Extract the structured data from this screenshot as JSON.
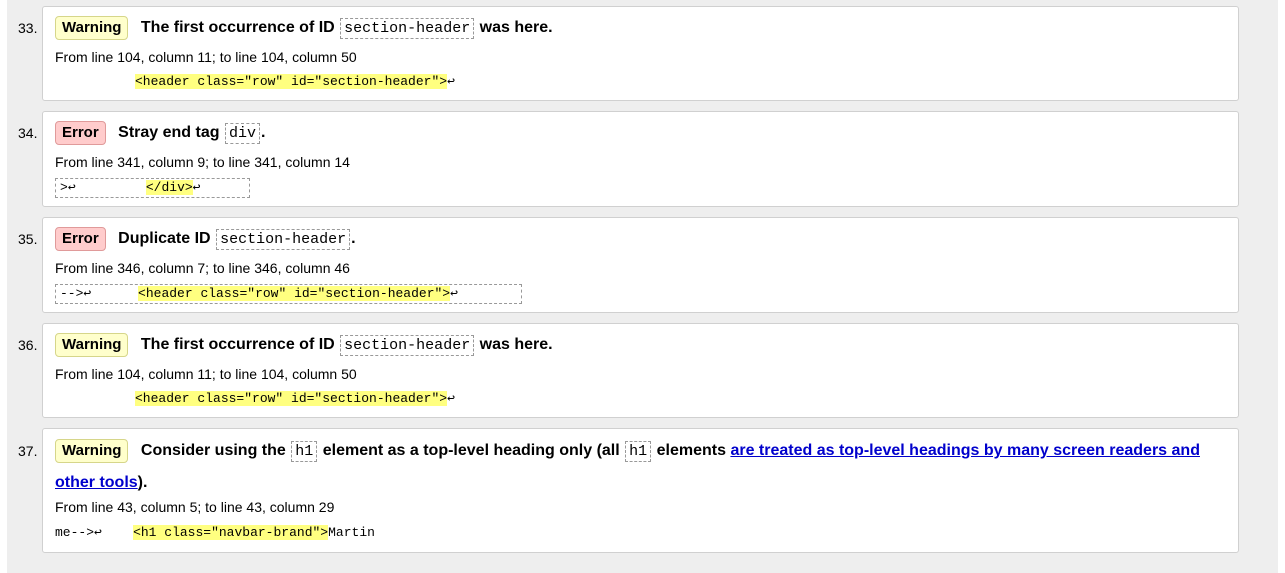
{
  "messages": [
    {
      "number": "33.",
      "type": "Warning",
      "text_before": "The first occurrence of ID",
      "code": "section-header",
      "text_after": "was here.",
      "location": "From line 104, column 11; to line 104, column 50",
      "extract_before": "",
      "extract_highlight": "<header class=\"row\" id=\"section-header\">",
      "extract_after": ""
    },
    {
      "number": "34.",
      "type": "Error",
      "text_before": "Stray end tag",
      "code": "div",
      "text_after": ".",
      "location": "From line 341, column 9; to line 341, column 14",
      "extract_before": ">",
      "extract_highlight": "</div>",
      "extract_after": ""
    },
    {
      "number": "35.",
      "type": "Error",
      "text_before": "Duplicate ID",
      "code": "section-header",
      "text_after": ".",
      "location": "From line 346, column 7; to line 346, column 46",
      "extract_before": "-->",
      "extract_highlight": "<header class=\"row\" id=\"section-header\">",
      "extract_after": ""
    },
    {
      "number": "36.",
      "type": "Warning",
      "text_before": "The first occurrence of ID",
      "code": "section-header",
      "text_after": "was here.",
      "location": "From line 104, column 11; to line 104, column 50",
      "extract_before": "",
      "extract_highlight": "<header class=\"row\" id=\"section-header\">",
      "extract_after": ""
    },
    {
      "number": "37.",
      "type": "Warning",
      "text_before": "Consider using the",
      "code": "h1",
      "text_middle": "element as a top-level heading only (all",
      "code2": "h1",
      "text_middle2": "elements",
      "link_text": "are treated as top-level headings by many screen readers and other tools",
      "text_after": ").",
      "location": "From line 43, column 5; to line 43, column 29",
      "extract_before": "me-->",
      "extract_highlight": "<h1 class=\"navbar-brand\">",
      "extract_after": "Martin"
    }
  ],
  "return_glyph": "↩",
  "colors": {
    "warning_bg": "#ffffcc",
    "error_bg": "#ffcccc",
    "highlight": "#ffff80",
    "link": "#0000cc"
  }
}
